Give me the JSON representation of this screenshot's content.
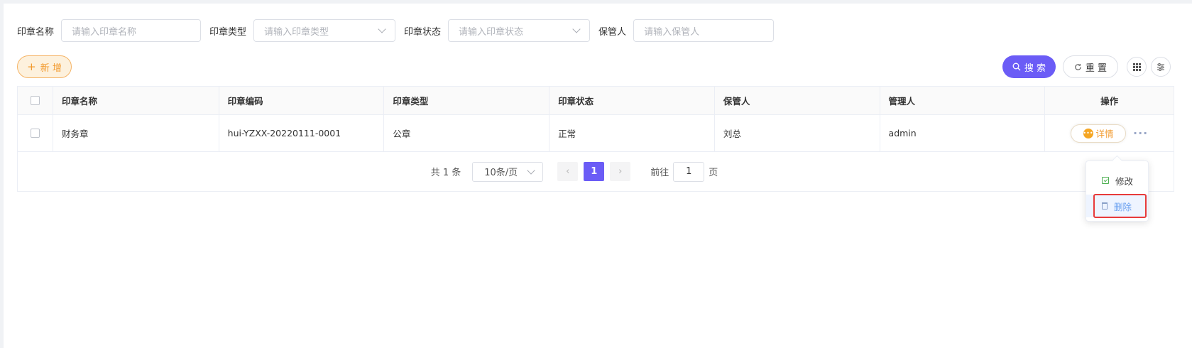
{
  "filters": {
    "name_label": "印章名称",
    "name_placeholder": "请输入印章名称",
    "type_label": "印章类型",
    "type_placeholder": "请输入印章类型",
    "status_label": "印章状态",
    "status_placeholder": "请输入印章状态",
    "keeper_label": "保管人",
    "keeper_placeholder": "请输入保管人"
  },
  "toolbar": {
    "add_label": "新 增",
    "search_label": "搜 索",
    "reset_label": "重 置"
  },
  "table": {
    "headers": [
      "印章名称",
      "印章编码",
      "印章类型",
      "印章状态",
      "保管人",
      "管理人",
      "操作"
    ],
    "rows": [
      {
        "name": "财务章",
        "code": "hui-YZXX-20220111-0001",
        "type": "公章",
        "status": "正常",
        "keeper": "刘总",
        "manager": "admin",
        "detail_label": "详情"
      }
    ]
  },
  "pagination": {
    "total_text": "共 1 条",
    "page_size": "10条/页",
    "current_page": "1",
    "goto_label": "前往",
    "goto_value": "1",
    "page_suffix": "页"
  },
  "dropdown": {
    "edit_label": "修改",
    "delete_label": "删除"
  },
  "colors": {
    "primary": "#6b5cf6",
    "warning": "#f29a2e",
    "highlight_border": "#e83a3a"
  }
}
